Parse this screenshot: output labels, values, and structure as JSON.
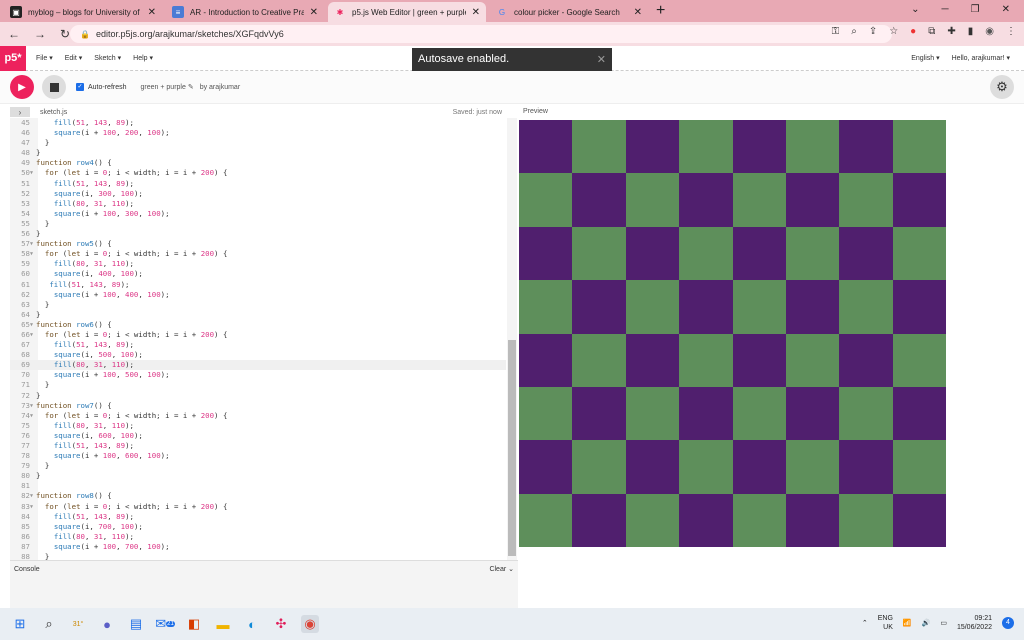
{
  "browser": {
    "tabs": [
      {
        "title": "myblog – blogs for University of",
        "favicon": "blog-icon",
        "color": "#222222",
        "glyph": "▣"
      },
      {
        "title": "AR - Introduction to Creative Pra",
        "favicon": "doc-icon",
        "color": "#4a7bd5",
        "glyph": "≡"
      },
      {
        "title": "p5.js Web Editor | green + purple",
        "favicon": "p5-star-icon",
        "color": "#ed225d",
        "glyph": "✱"
      },
      {
        "title": "colour picker - Google Search",
        "favicon": "google-icon",
        "color": "#ffffff",
        "glyph": "G"
      }
    ],
    "url": "editor.p5js.org/arajkumar/sketches/XGFqdvVy6"
  },
  "p5": {
    "logo": "p5*",
    "menu": [
      "File ▾",
      "Edit ▾",
      "Sketch ▾",
      "Help ▾"
    ],
    "language": "English ▾",
    "user": "Hello, arajkumar! ▾",
    "toast": "Autosave enabled.",
    "auto_refresh": "Auto-refresh",
    "sketch_name": "green + purple ✎",
    "by_author": "by arajkumar",
    "file_name": "sketch.js",
    "saved_status": "Saved: just now",
    "preview_label": "Preview",
    "console_label": "Console",
    "clear_label": "Clear"
  },
  "code_lines": [
    {
      "n": "45",
      "t": "    fill(51, 143, 89);"
    },
    {
      "n": "46",
      "t": "    square(i + 100, 200, 100);"
    },
    {
      "n": "47",
      "t": "  }"
    },
    {
      "n": "48",
      "t": "}"
    },
    {
      "n": "49",
      "t": "function row4() {"
    },
    {
      "n": "50",
      "t": "  for (let i = 0; i < width; i = i + 200) {",
      "fold": true
    },
    {
      "n": "51",
      "t": "    fill(51, 143, 89);"
    },
    {
      "n": "52",
      "t": "    square(i, 300, 100);"
    },
    {
      "n": "53",
      "t": "    fill(80, 31, 110);"
    },
    {
      "n": "54",
      "t": "    square(i + 100, 300, 100);"
    },
    {
      "n": "55",
      "t": "  }"
    },
    {
      "n": "56",
      "t": "}"
    },
    {
      "n": "57",
      "t": "function row5() {",
      "fold": true
    },
    {
      "n": "58",
      "t": "  for (let i = 0; i < width; i = i + 200) {",
      "fold": true
    },
    {
      "n": "59",
      "t": "    fill(80, 31, 110);"
    },
    {
      "n": "60",
      "t": "    square(i, 400, 100);"
    },
    {
      "n": "61",
      "t": "   fill(51, 143, 89);"
    },
    {
      "n": "62",
      "t": "    square(i + 100, 400, 100);"
    },
    {
      "n": "63",
      "t": "  }"
    },
    {
      "n": "64",
      "t": "}"
    },
    {
      "n": "65",
      "t": "function row6() {",
      "fold": true
    },
    {
      "n": "66",
      "t": "  for (let i = 0; i < width; i = i + 200) {",
      "fold": true
    },
    {
      "n": "67",
      "t": "    fill(51, 143, 89);"
    },
    {
      "n": "68",
      "t": "    square(i, 500, 100);"
    },
    {
      "n": "69",
      "t": "    fill(80, 31, 110);",
      "hl": true
    },
    {
      "n": "70",
      "t": "    square(i + 100, 500, 100);"
    },
    {
      "n": "71",
      "t": "  }"
    },
    {
      "n": "72",
      "t": "}"
    },
    {
      "n": "73",
      "t": "function row7() {",
      "fold": true
    },
    {
      "n": "74",
      "t": "  for (let i = 0; i < width; i = i + 200) {",
      "fold": true
    },
    {
      "n": "75",
      "t": "    fill(80, 31, 110);"
    },
    {
      "n": "76",
      "t": "    square(i, 600, 100);"
    },
    {
      "n": "77",
      "t": "    fill(51, 143, 89);"
    },
    {
      "n": "78",
      "t": "    square(i + 100, 600, 100);"
    },
    {
      "n": "79",
      "t": "  }"
    },
    {
      "n": "80",
      "t": "}"
    },
    {
      "n": "81",
      "t": ""
    },
    {
      "n": "82",
      "t": "function row8() {",
      "fold": true
    },
    {
      "n": "83",
      "t": "  for (let i = 0; i < width; i = i + 200) {",
      "fold": true
    },
    {
      "n": "84",
      "t": "    fill(51, 143, 89);"
    },
    {
      "n": "85",
      "t": "    square(i, 700, 100);"
    },
    {
      "n": "86",
      "t": "    fill(80, 31, 110);"
    },
    {
      "n": "87",
      "t": "    square(i + 100, 700, 100);"
    },
    {
      "n": "88",
      "t": "  }"
    }
  ],
  "preview": {
    "purple": "#501f6e",
    "green": "#5e8f5b",
    "grid": 8
  },
  "taskbar": {
    "weather": "31°",
    "mail_badge": "21",
    "lang": "ENG",
    "region": "UK",
    "time": "09:21",
    "date": "15/06/2022",
    "notif": "4"
  }
}
